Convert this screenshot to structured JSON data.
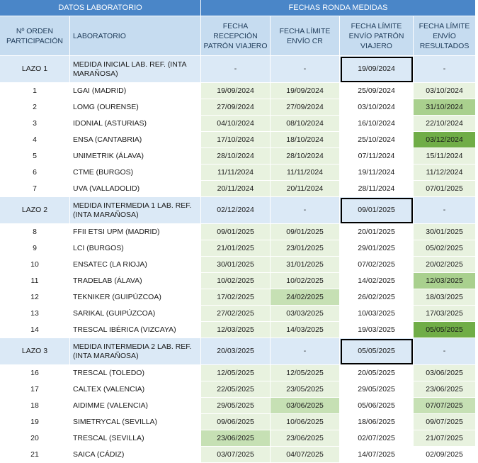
{
  "header_groups": {
    "left": "DATOS LABORATORIO",
    "right": "FECHAS RONDA MEDIDAS"
  },
  "columns": {
    "order": "Nº ORDEN PARTICIPACIÓN",
    "lab": "LABORATORIO",
    "reception": "FECHA RECEPCIÓN PATRÓN VIAJERO",
    "limit_cr": "FECHA LÍMITE ENVÍO CR",
    "limit_patron": "FECHA LÍMITE ENVÍO PATRÓN VIAJERO",
    "limit_results": "FECHA LÍMITE ENVÍO RESULTADOS"
  },
  "rows": [
    {
      "type": "lazo",
      "order": "LAZO 1",
      "lab": "MEDIDA INICIAL LAB. REF. (INTA MARAÑOSA)",
      "reception": "-",
      "limit_cr": "-",
      "limit_patron": "19/09/2024",
      "limit_results": "-"
    },
    {
      "type": "row",
      "order": "1",
      "lab": "LGAI (MADRID)",
      "reception": "19/09/2024",
      "limit_cr": "19/09/2024",
      "limit_patron": "25/09/2024",
      "limit_results": "03/10/2024"
    },
    {
      "type": "row",
      "order": "2",
      "lab": "LOMG (OURENSE)",
      "reception": "27/09/2024",
      "limit_cr": "27/09/2024",
      "limit_patron": "03/10/2024",
      "limit_results": "31/10/2024",
      "hl_results": "mid"
    },
    {
      "type": "row",
      "order": "3",
      "lab": "IDONIAL (ASTURIAS)",
      "reception": "04/10/2024",
      "limit_cr": "08/10/2024",
      "limit_patron": "16/10/2024",
      "limit_results": "22/10/2024"
    },
    {
      "type": "row",
      "order": "4",
      "lab": "ENSA (CANTABRIA)",
      "reception": "17/10/2024",
      "limit_cr": "18/10/2024",
      "limit_patron": "25/10/2024",
      "limit_results": "03/12/2024",
      "hl_results": "dark"
    },
    {
      "type": "row",
      "order": "5",
      "lab": "UNIMETRIK (ÁLAVA)",
      "reception": "28/10/2024",
      "limit_cr": "28/10/2024",
      "limit_patron": "07/11/2024",
      "limit_results": "15/11/2024"
    },
    {
      "type": "row",
      "order": "6",
      "lab": "CTME (BURGOS)",
      "reception": "11/11/2024",
      "limit_cr": "11/11/2024",
      "limit_patron": "19/11/2024",
      "limit_results": "11/12/2024"
    },
    {
      "type": "row",
      "order": "7",
      "lab": "UVA (VALLADOLID)",
      "reception": "20/11/2024",
      "limit_cr": "20/11/2024",
      "limit_patron": "28/11/2024",
      "limit_results": "07/01/2025"
    },
    {
      "type": "lazo",
      "order": "LAZO 2",
      "lab": "MEDIDA INTERMEDIA 1 LAB. REF. (INTA MARAÑOSA)",
      "reception": "02/12/2024",
      "limit_cr": "-",
      "limit_patron": "09/01/2025",
      "limit_results": "-"
    },
    {
      "type": "row",
      "order": "8",
      "lab": "FFII ETSI UPM (MADRID)",
      "reception": "09/01/2025",
      "limit_cr": "09/01/2025",
      "limit_patron": "20/01/2025",
      "limit_results": "30/01/2025"
    },
    {
      "type": "row",
      "order": "9",
      "lab": "LCI (BURGOS)",
      "reception": "21/01/2025",
      "limit_cr": "23/01/2025",
      "limit_patron": "29/01/2025",
      "limit_results": "05/02/2025"
    },
    {
      "type": "row",
      "order": "10",
      "lab": "ENSATEC (LA RIOJA)",
      "reception": "30/01/2025",
      "limit_cr": "31/01/2025",
      "limit_patron": "07/02/2025",
      "limit_results": "20/02/2025"
    },
    {
      "type": "row",
      "order": "11",
      "lab": "TRADELAB (ÁLAVA)",
      "reception": "10/02/2025",
      "limit_cr": "10/02/2025",
      "limit_patron": "14/02/2025",
      "limit_results": "12/03/2025",
      "hl_results": "mid"
    },
    {
      "type": "row",
      "order": "12",
      "lab": "TEKNIKER (GUIPÚZCOA)",
      "reception": "17/02/2025",
      "limit_cr": "24/02/2025",
      "limit_patron": "26/02/2025",
      "limit_results": "18/03/2025",
      "hl_cr": "light"
    },
    {
      "type": "row",
      "order": "13",
      "lab": "SARIKAL (GUIPÚZCOA)",
      "reception": "27/02/2025",
      "limit_cr": "03/03/2025",
      "limit_patron": "10/03/2025",
      "limit_results": "17/03/2025"
    },
    {
      "type": "row",
      "order": "14",
      "lab": "TRESCAL IBÉRICA (VIZCAYA)",
      "reception": "12/03/2025",
      "limit_cr": "14/03/2025",
      "limit_patron": "19/03/2025",
      "limit_results": "05/05/2025",
      "hl_results": "dark"
    },
    {
      "type": "lazo",
      "order": "LAZO 3",
      "lab": "MEDIDA INTERMEDIA 2 LAB. REF. (INTA MARAÑOSA)",
      "reception": "20/03/2025",
      "limit_cr": "-",
      "limit_patron": "05/05/2025",
      "limit_results": "-"
    },
    {
      "type": "row",
      "order": "16",
      "lab": "TRESCAL (TOLEDO)",
      "reception": "12/05/2025",
      "limit_cr": "12/05/2025",
      "limit_patron": "20/05/2025",
      "limit_results": "03/06/2025"
    },
    {
      "type": "row",
      "order": "17",
      "lab": "CALTEX (VALENCIA)",
      "reception": "22/05/2025",
      "limit_cr": "23/05/2025",
      "limit_patron": "29/05/2025",
      "limit_results": "23/06/2025"
    },
    {
      "type": "row",
      "order": "18",
      "lab": "AIDIMME (VALENCIA)",
      "reception": "29/05/2025",
      "limit_cr": "03/06/2025",
      "limit_patron": "05/06/2025",
      "limit_results": "07/07/2025",
      "hl_cr": "light",
      "hl_results": "light"
    },
    {
      "type": "row",
      "order": "19",
      "lab": "SIMETRYCAL (SEVILLA)",
      "reception": "09/06/2025",
      "limit_cr": "10/06/2025",
      "limit_patron": "18/06/2025",
      "limit_results": "09/07/2025"
    },
    {
      "type": "row",
      "order": "20",
      "lab": "TRESCAL (SEVILLA)",
      "reception": "23/06/2025",
      "limit_cr": "23/06/2025",
      "limit_patron": "02/07/2025",
      "limit_results": "21/07/2025",
      "hl_reception": "light"
    },
    {
      "type": "row",
      "order": "21",
      "lab": "SAICA (CÁDIZ)",
      "reception": "03/07/2025",
      "limit_cr": "04/07/2025",
      "limit_patron": "14/07/2025",
      "limit_results": "02/09/2025",
      "hl_results": "none"
    }
  ]
}
